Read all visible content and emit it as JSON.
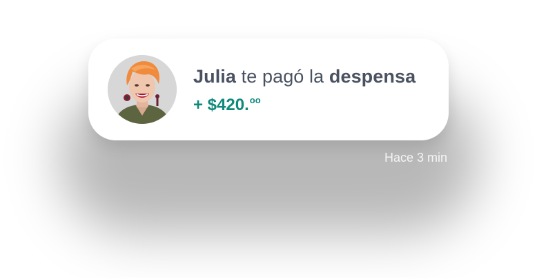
{
  "notification": {
    "sender_name": "Julia",
    "message_middle": "te pagó la",
    "message_object": "despensa",
    "amount_prefix": "+ $420.",
    "amount_cents": "oo",
    "timestamp": "Hace 3 min",
    "avatar_icon": "person-photo-avatar"
  },
  "colors": {
    "text": "#4a5261",
    "amount": "#0e8a7b",
    "card": "#ffffff"
  }
}
